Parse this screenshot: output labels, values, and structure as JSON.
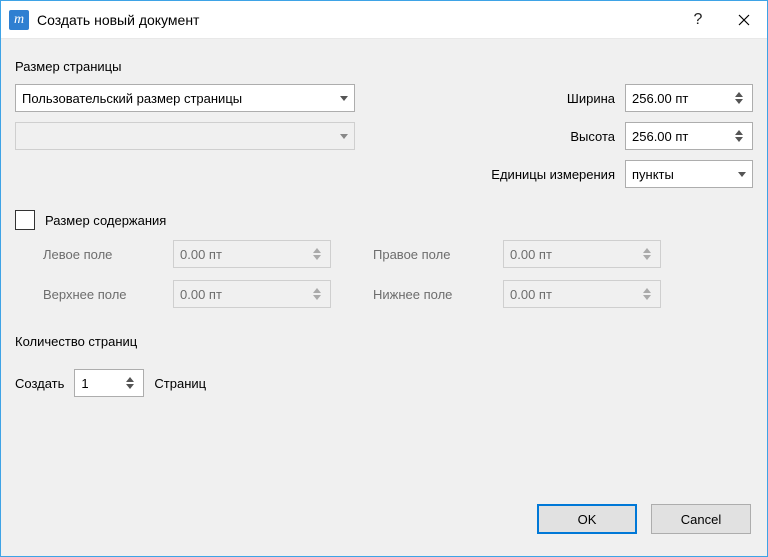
{
  "titlebar": {
    "title": "Создать новый документ"
  },
  "page_size": {
    "group_label": "Размер страницы",
    "preset": "Пользовательский размер страницы",
    "secondary": "",
    "width_label": "Ширина",
    "width_value": "256.00 пт",
    "height_label": "Высота",
    "height_value": "256.00 пт",
    "units_label": "Единицы измерения",
    "units_value": "пункты"
  },
  "content_size": {
    "group_label": "Размер содержания",
    "checked": false,
    "left_label": "Левое поле",
    "left_value": "0.00 пт",
    "top_label": "Верхнее поле",
    "top_value": "0.00 пт",
    "right_label": "Правое поле",
    "right_value": "0.00 пт",
    "bottom_label": "Нижнее поле",
    "bottom_value": "0.00 пт"
  },
  "pages": {
    "group_label": "Количество страниц",
    "create_label": "Создать",
    "count": "1",
    "suffix": "Страниц"
  },
  "buttons": {
    "ok": "OK",
    "cancel": "Cancel"
  }
}
